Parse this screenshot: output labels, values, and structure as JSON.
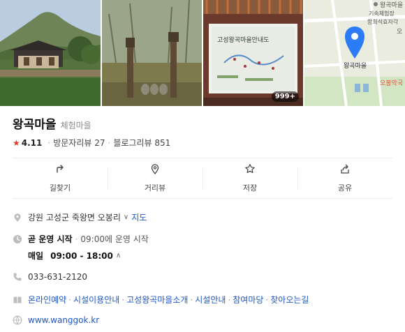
{
  "place": {
    "name": "왕곡마을",
    "category": "체험마을",
    "rating": "4.11",
    "visitor_reviews": "방문자리뷰 27",
    "blog_reviews": "블로그리뷰 851"
  },
  "photos": {
    "count_badge": "999+",
    "map_labels": {
      "poi_1": "왕곡마을",
      "poi_1_line2": "기속체험장",
      "poi_2": "함희석효자각",
      "poi_3": "오",
      "pin_label": "왕곡마을",
      "poi_4": "오봉막국"
    },
    "sign_title": "고성왕곡마을안내도"
  },
  "actions": [
    {
      "label": "길찾기",
      "icon": "directions-icon"
    },
    {
      "label": "거리뷰",
      "icon": "street-view-icon"
    },
    {
      "label": "저장",
      "icon": "star-icon"
    },
    {
      "label": "공유",
      "icon": "share-icon"
    }
  ],
  "info": {
    "address": "강원 고성군 죽왕면 오봉리",
    "map_link": "지도",
    "hours_status": "곧 운영 시작",
    "hours_note": "09:00에 운영 시작",
    "hours_days": "매일",
    "hours_range": "09:00 - 18:00",
    "phone": "033-631-2120",
    "menu_links": [
      "온라인예약",
      "시설이용안내",
      "고성왕곡마을소개",
      "시설안내",
      "참여마당",
      "찾아오는길"
    ],
    "website": "www.wanggok.kr"
  },
  "colors": {
    "link": "#1b57c8",
    "rating_star": "#e63b2e",
    "map_pin": "#2b7cf6"
  }
}
